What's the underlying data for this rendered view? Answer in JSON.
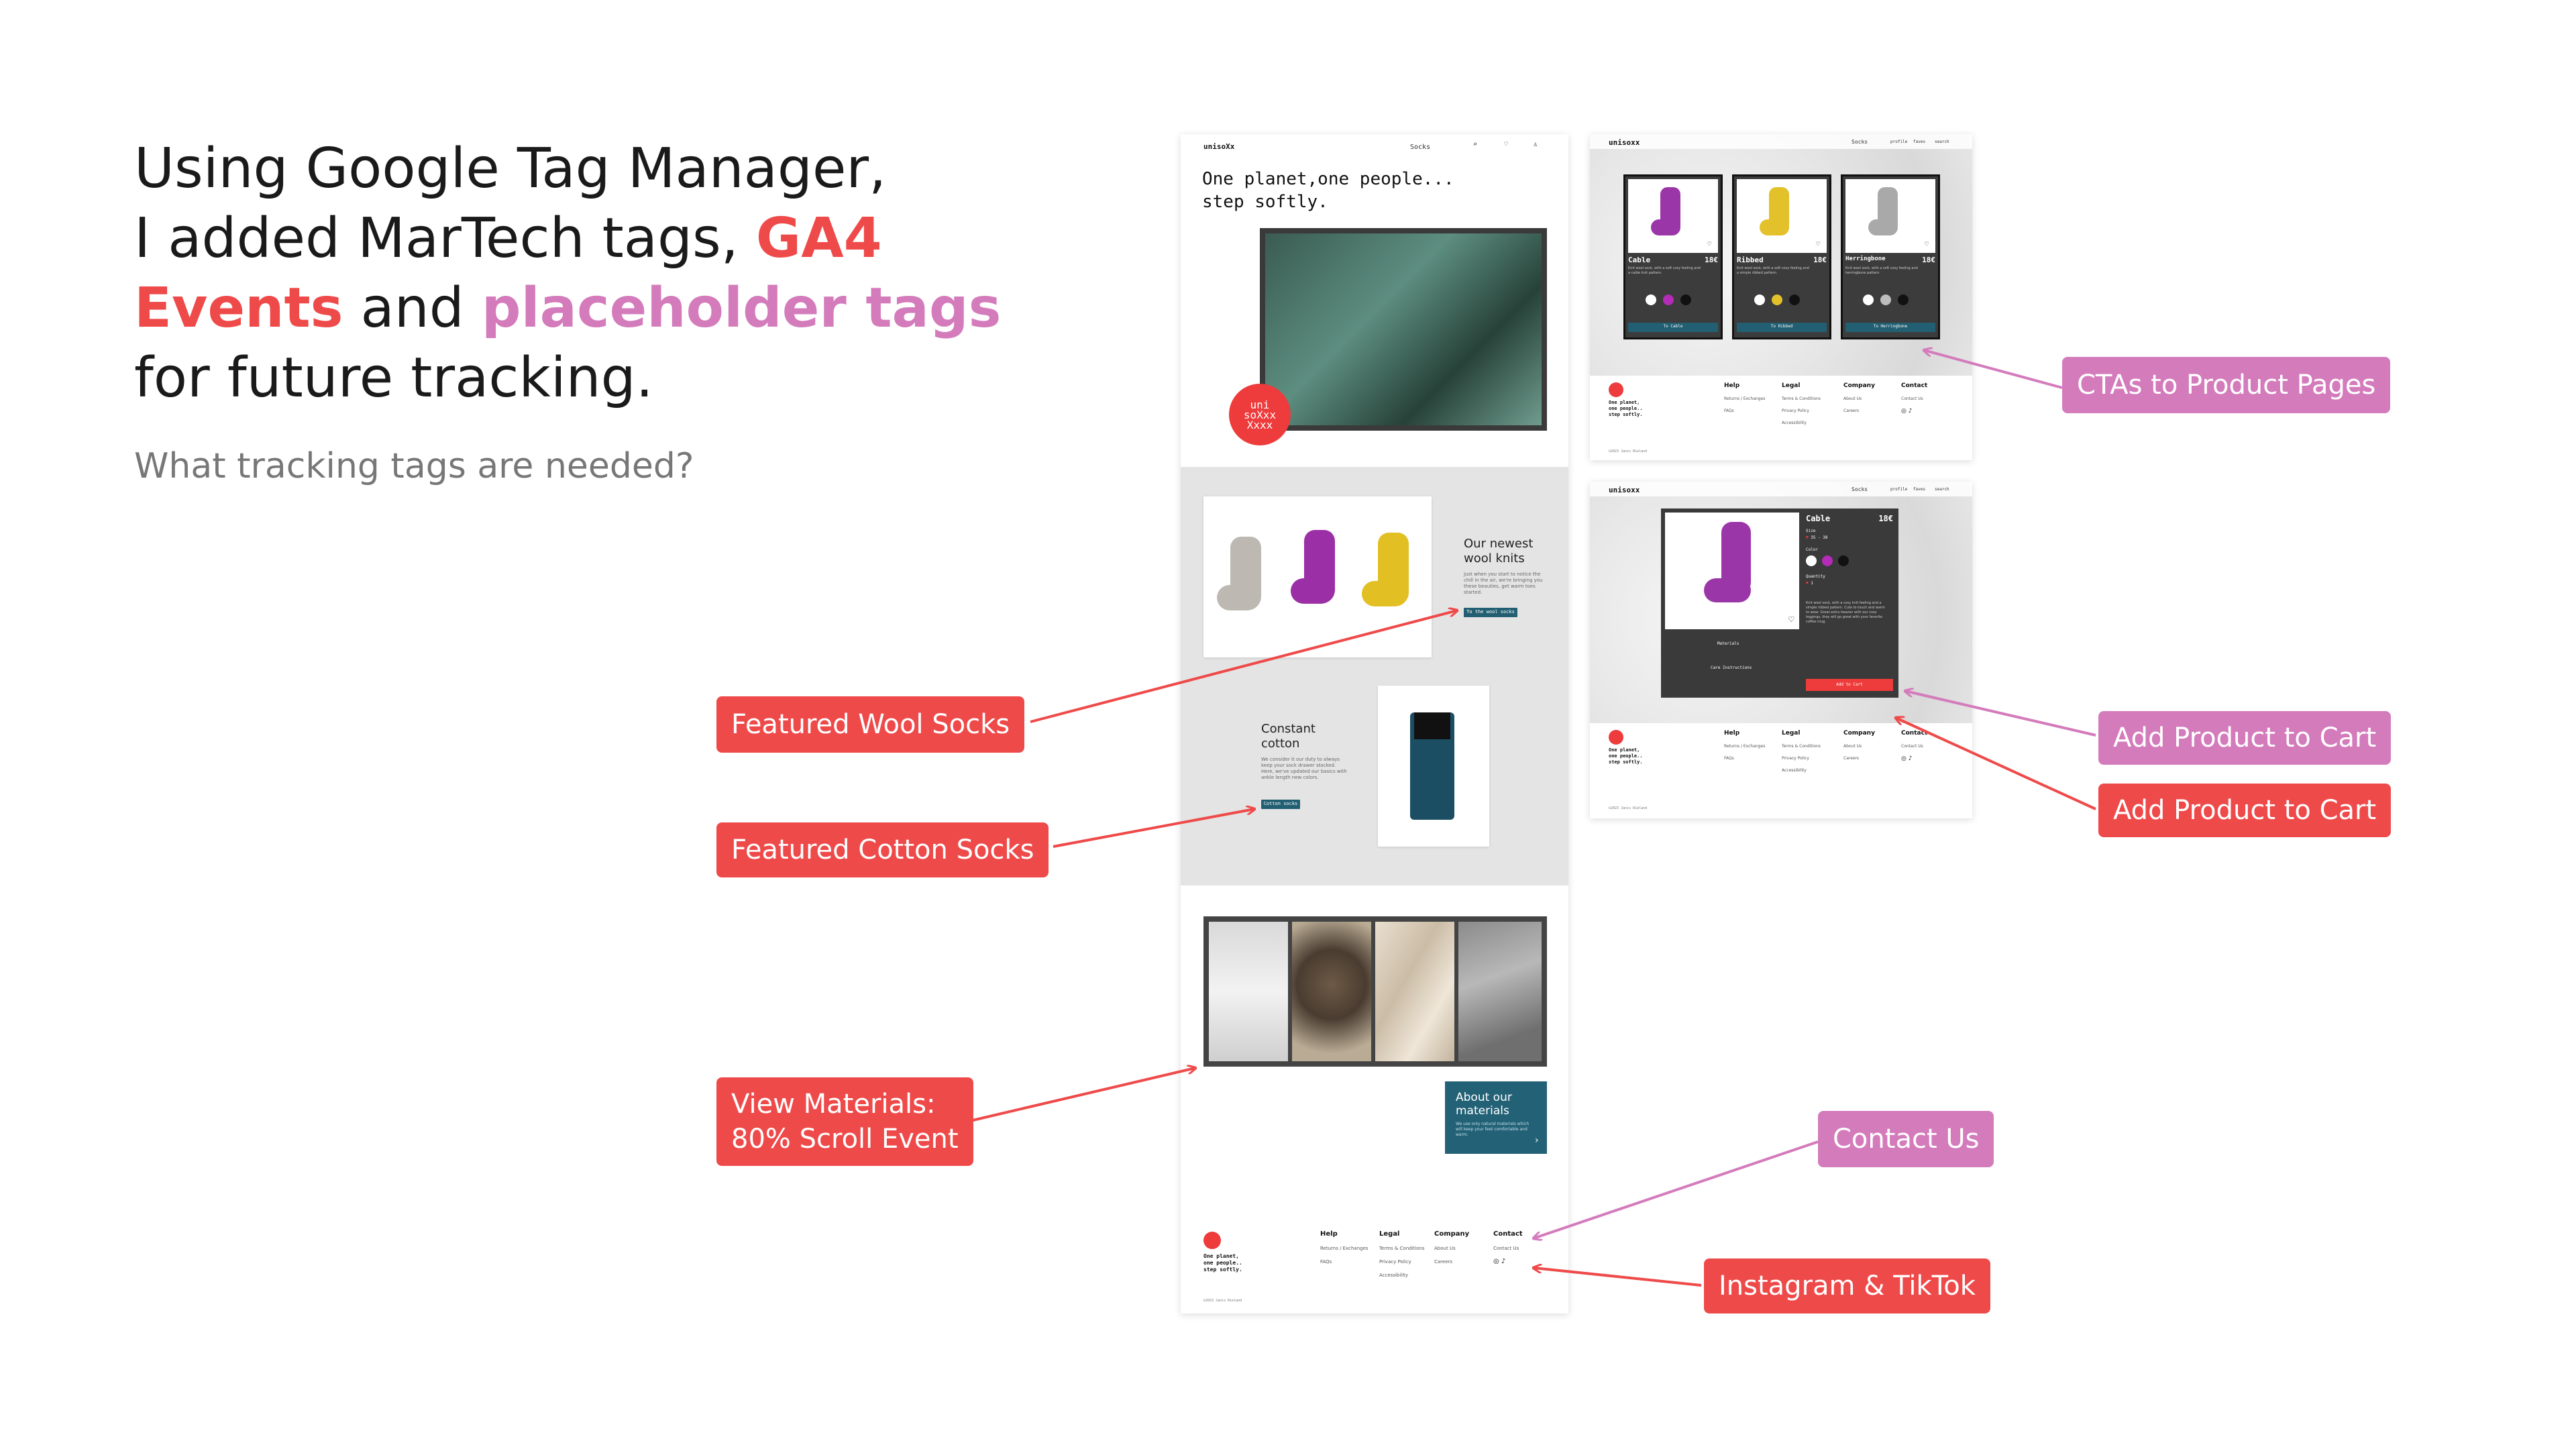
{
  "headline": {
    "line1": "Using Google Tag Manager,",
    "line2_pre": "I added MarTech tags, ",
    "line2_red": "GA4",
    "line3_red": "Events",
    "line3_mid": " and ",
    "line3_pink": "placeholder tags",
    "line4": "for future tracking."
  },
  "subhead": "What tracking tags are needed?",
  "colors": {
    "red": "#ef4a4a",
    "pink": "#d47bbc",
    "teal_button": "#225f72"
  },
  "callouts": {
    "featured_wool": "Featured Wool Socks",
    "featured_cotton": "Featured Cotton Socks",
    "view_materials_1": "View Materials:",
    "view_materials_2": "80% Scroll Event",
    "ctas_product_pages": "CTAs to Product Pages",
    "add_to_cart_pink": "Add Product to Cart",
    "add_to_cart_red": "Add Product to Cart",
    "contact_us": "Contact Us",
    "instagram_tiktok": "Instagram & TikTok"
  },
  "home_mock": {
    "logo": "unisoXx",
    "nav_socks": "Socks",
    "hero_line1": "One planet,one people...",
    "hero_line2": "step softly.",
    "stamp_line1": "uni",
    "stamp_line2": "soXxx",
    "stamp_line3": "Xxxx",
    "wool_heading_1": "Our newest",
    "wool_heading_2": "wool knits",
    "wool_copy": "Just when you start to notice the chill in the air, we're bringing you these beauties, get warm toes started.",
    "wool_btn": "To the wool socks",
    "cotton_heading_1": "Constant",
    "cotton_heading_2": "cotton",
    "cotton_copy": "We consider it our duty to always keep your sock drawer stocked. Here, we've updated our basics with ankle length new colors.",
    "cotton_btn": "Cotton socks",
    "about_1": "About our",
    "about_2": "materials",
    "about_copy": "We use only natural materials which will keep your feet comfortable and warm.",
    "about_arrow": "›",
    "footer_tagline_1": "One planet,",
    "footer_tagline_2": "one people..",
    "footer_tagline_3": "step softly.",
    "footer_copyright": "©2023 Janis Rieland",
    "footer_cols": [
      {
        "title": "Help",
        "items": [
          "Returns / Exchanges",
          "FAQs"
        ]
      },
      {
        "title": "Legal",
        "items": [
          "Terms & Conditions",
          "Privacy Policy",
          "Accessibility"
        ]
      },
      {
        "title": "Company",
        "items": [
          "About Us",
          "Careers"
        ]
      },
      {
        "title": "Contact",
        "items": [
          "Contact Us"
        ]
      }
    ],
    "social_icons": "◎ ♪"
  },
  "listing_mock": {
    "logo": "unisoxx",
    "nav": [
      "Socks",
      "profile",
      "faves",
      "search"
    ],
    "products": [
      {
        "name": "Cable",
        "price": "18€",
        "desc": "Knit wool sock, with a soft cosy feeling and a cable knit pattern.",
        "btn": "To Cable",
        "color": "#9b36a8",
        "dots": [
          "#ffffff",
          "#b42bb8",
          "#111111"
        ]
      },
      {
        "name": "Ribbed",
        "price": "18€",
        "desc": "Knit wool sock, with a soft cosy feeling and a simple ribbed pattern.",
        "btn": "To Ribbed",
        "color": "#e2c12a",
        "dots": [
          "#ffffff",
          "#e3c12b",
          "#111111"
        ]
      },
      {
        "name": "Herringbone",
        "price": "18€",
        "desc": "Knit wool sock, with a soft cosy feeling and herringbone pattern.",
        "btn": "To Herringbone",
        "color": "#a9a9a9",
        "dots": [
          "#ffffff",
          "#bdbdbd",
          "#111111"
        ]
      }
    ],
    "footer_tagline_1": "One planet,",
    "footer_tagline_2": "one people..",
    "footer_tagline_3": "step softly.",
    "footer_copyright": "©2023 Janis Rieland"
  },
  "product_mock": {
    "logo": "unisoxx",
    "nav": [
      "Socks",
      "profile",
      "faves",
      "search"
    ],
    "name": "Cable",
    "price": "18€",
    "size_label": "Size",
    "size_value": "35 - 38",
    "color_label": "Color",
    "quantity_label": "Quantity",
    "quantity_value": "1",
    "materials_label": "Materials",
    "care_label": "Care Instructions",
    "desc": "Knit wool sock, with a cosy knit feeling and a simple ribbed pattern. Cute to touch and warm to wear. Great extra heavier with our cozy leggings, they will go great with your favorite coffee mug.",
    "add_btn": "Add to Cart",
    "dots": [
      "#ffffff",
      "#b42bb8",
      "#111111"
    ],
    "footer_tagline_1": "One planet,",
    "footer_tagline_2": "one people..",
    "footer_tagline_3": "step softly.",
    "footer_copyright": "©2023 Janis Rieland"
  }
}
